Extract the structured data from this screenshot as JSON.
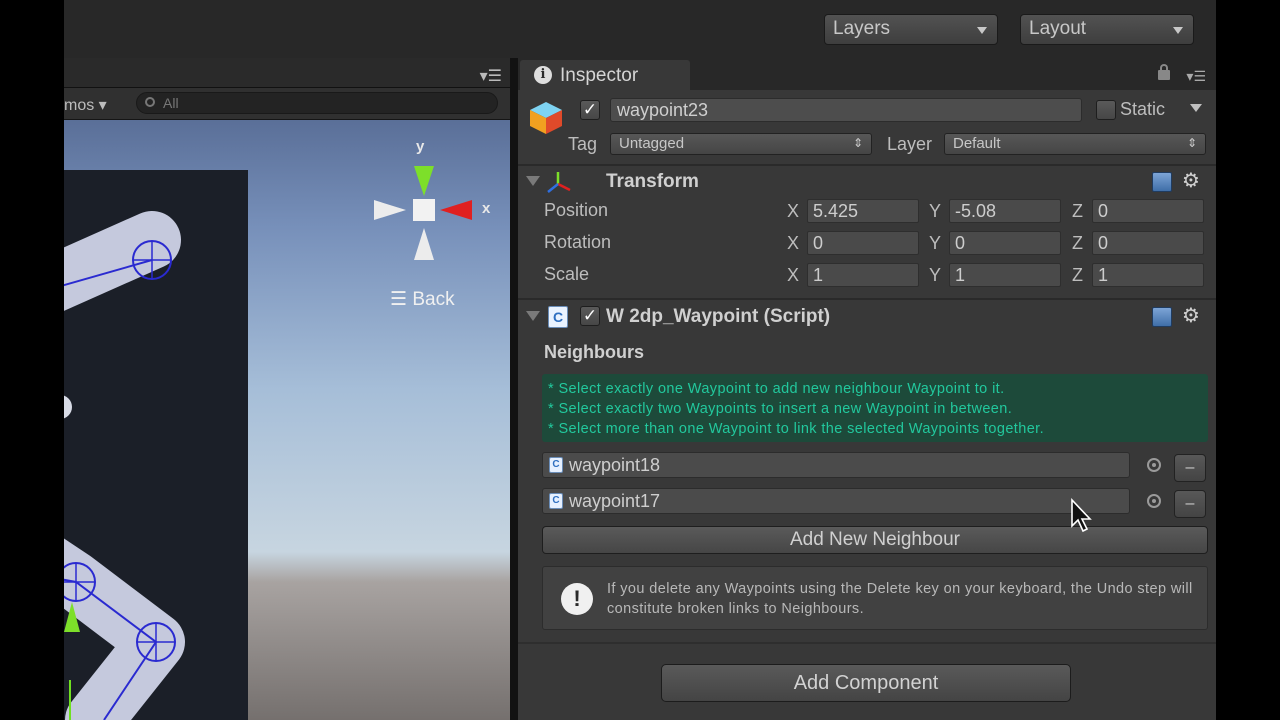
{
  "toolbar": {
    "layers_label": "Layers",
    "layout_label": "Layout"
  },
  "scene": {
    "gizmos_label": "mos",
    "search_placeholder": "All",
    "back_label": "Back",
    "axis_y": "y",
    "axis_x": "x"
  },
  "inspector": {
    "tab_label": "Inspector",
    "object": {
      "active": true,
      "name": "waypoint23",
      "static_label": "Static",
      "tag_label": "Tag",
      "tag_value": "Untagged",
      "layer_label": "Layer",
      "layer_value": "Default"
    },
    "transform": {
      "title": "Transform",
      "rows": [
        {
          "label": "Position",
          "x": "5.425",
          "y": "-5.08",
          "z": "0"
        },
        {
          "label": "Rotation",
          "x": "0",
          "y": "0",
          "z": "0"
        },
        {
          "label": "Scale",
          "x": "1",
          "y": "1",
          "z": "1"
        }
      ],
      "axis_x": "X",
      "axis_y": "Y",
      "axis_z": "Z"
    },
    "script": {
      "title": "W 2dp_Waypoint (Script)",
      "enabled": true,
      "neighbours_label": "Neighbours",
      "help_lines": [
        "* Select exactly one Waypoint to add new neighbour Waypoint to it.",
        "* Select exactly two Waypoints to insert a new Waypoint in between.",
        "* Select more than one Waypoint to link the selected Waypoints together."
      ],
      "neighbours": [
        "waypoint18",
        "waypoint17"
      ],
      "remove_label": "–",
      "add_neighbour_label": "Add New Neighbour",
      "warning_text": "If you delete any Waypoints using the Delete key on your keyboard, the Undo step will constitute broken links to Neighbours."
    },
    "add_component_label": "Add Component"
  },
  "colors": {
    "panel_bg": "#383838",
    "help_bg": "#1d4a3a",
    "help_text": "#22c89d",
    "gizmo_green": "#7ddf2a",
    "gizmo_red": "#e02020",
    "path_blue": "#2020d0"
  }
}
